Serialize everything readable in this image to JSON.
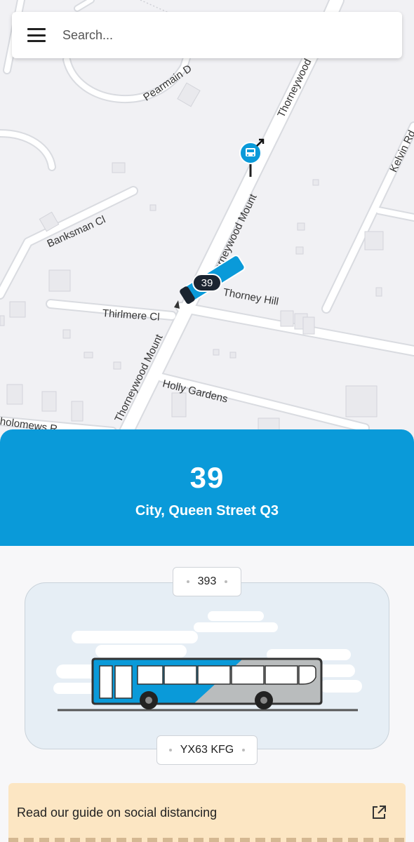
{
  "search": {
    "placeholder": "Search..."
  },
  "map": {
    "streets": [
      "Thorneywood Mount",
      "Thorneywood Mount",
      "Thorneywood",
      "Thorney Hill",
      "Thirlmere Cl",
      "Holly Gardens",
      "Banksman Cl",
      "Pearmain D",
      "Kelvin Rd",
      "holomews R"
    ],
    "bus_marker_label": "39",
    "bus_stop_icon": "bus-stop-icon"
  },
  "route": {
    "number": "39",
    "destination": "City, Queen Street Q3"
  },
  "vehicle": {
    "fleet_number": "393",
    "registration": "YX63 KFG",
    "colors": {
      "primary": "#0a9ad9",
      "secondary": "#b9bcbd"
    }
  },
  "guide": {
    "label": "Read our guide on social distancing",
    "icon": "external-link-icon"
  }
}
